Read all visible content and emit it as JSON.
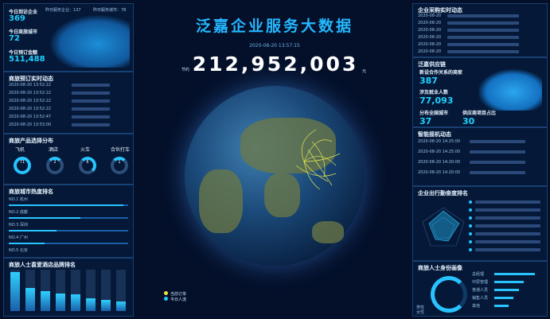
{
  "header": {
    "title": "泛嘉企业服务大数据",
    "datetime": "2020-08-20 13:57:15",
    "counter": "212,952,003",
    "counter_prefix": "节约",
    "counter_suffix": "元"
  },
  "top_left": {
    "stat1_label": "今日到访企业",
    "stat1_value": "369",
    "stat2_label": "今日商旅城市",
    "stat2_value": "72",
    "stat3_label": "今日预订金额",
    "stat3_value": "511,488",
    "map_top1": "昨日服务企业：137",
    "map_top2": "昨日服务城市：78"
  },
  "booking": {
    "title": "商旅预订实时动态",
    "rows": [
      "2020-08-20 13:52:22",
      "2020-08-20 13:52:22",
      "2020-08-20 13:52:22",
      "2020-08-20 13:52:22",
      "2020-08-20 13:52:47",
      "2020-08-20 13:53:00"
    ]
  },
  "product": {
    "title": "商旅产品选择分布",
    "items": [
      {
        "label": "飞机",
        "value": "71"
      },
      {
        "label": "酒店",
        "value": "2"
      },
      {
        "label": "火车",
        "value": "6"
      },
      {
        "label": "合伙打车",
        "value": "1"
      }
    ]
  },
  "city_rank": {
    "title": "商旅城市热度排名",
    "items": [
      "NO.1 杭州",
      "NO.2 成都",
      "NO.3 深圳",
      "NO.4 广州",
      "NO.5 北京"
    ]
  },
  "hotel_rank": {
    "title": "商旅人士喜爱酒店品牌排名",
    "values": [
      95,
      55,
      48,
      42,
      40,
      30,
      26,
      24
    ]
  },
  "right_top": {
    "title": "企业采购实时动态",
    "dates": [
      "2020-08-20",
      "2020-08-20",
      "2020-08-20",
      "2020-08-20",
      "2020-08-20",
      "2020-08-20"
    ]
  },
  "supply": {
    "title": "泛嘉供应链",
    "label1": "新设合作关系的商家",
    "value1": "387",
    "label2": "涉及就业人数",
    "value2": "77,093",
    "label3": "分布全国城市",
    "value3": "37",
    "label4": "供应商项目占比",
    "value4": "30"
  },
  "smart": {
    "title": "智能接机动态",
    "rows": [
      "2020-08-20 14:25:00",
      "2020-08-20 14:25:00",
      "2020-08-20 14:20:00",
      "2020-08-20 14:20:00"
    ]
  },
  "travel_rank": {
    "title": "企业出行勤奋度排名",
    "rows": 7
  },
  "identity": {
    "title": "商旅人士身份画像",
    "labels": [
      "总经理",
      "中层管理",
      "普通人员",
      "销售人员",
      "其他"
    ],
    "values": [
      0.85,
      0.62,
      0.52,
      0.4,
      0.3
    ],
    "donut_labels": [
      "男性",
      "女性"
    ]
  },
  "legend": {
    "item1": "当前订单",
    "item2": "今日人流"
  }
}
